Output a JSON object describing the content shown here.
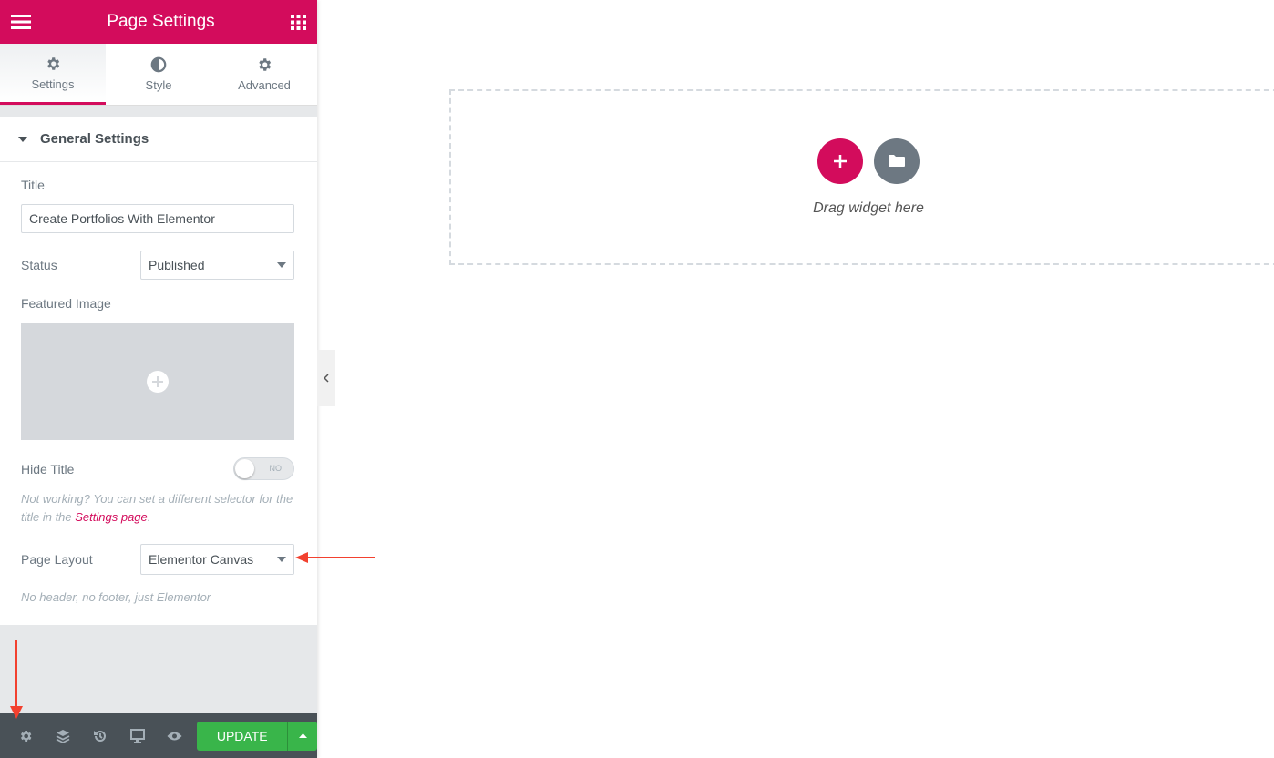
{
  "header": {
    "title": "Page Settings",
    "menu_icon": "hamburger-icon",
    "apps_icon": "grid-icon"
  },
  "tabs": [
    {
      "label": "Settings",
      "icon": "gear-icon",
      "active": true
    },
    {
      "label": "Style",
      "icon": "contrast-icon"
    },
    {
      "label": "Advanced",
      "icon": "gear-icon"
    }
  ],
  "section": {
    "title": "General Settings"
  },
  "fields": {
    "title_label": "Title",
    "title_value": "Create Portfolios With Elementor",
    "status_label": "Status",
    "status_value": "Published",
    "featured_label": "Featured Image",
    "hide_title_label": "Hide Title",
    "hide_title_toggle": "NO",
    "hide_note_pre": "Not working? You can set a different selector for the title in the ",
    "hide_note_link": "Settings page",
    "hide_note_post": ".",
    "layout_label": "Page Layout",
    "layout_value": "Elementor Canvas",
    "layout_note": "No header, no footer, just Elementor"
  },
  "footer": {
    "update_label": "UPDATE"
  },
  "canvas": {
    "drop_text": "Drag widget here"
  },
  "colors": {
    "brand": "#d30c5c",
    "update": "#39b54a",
    "annotation": "#f2412f"
  }
}
